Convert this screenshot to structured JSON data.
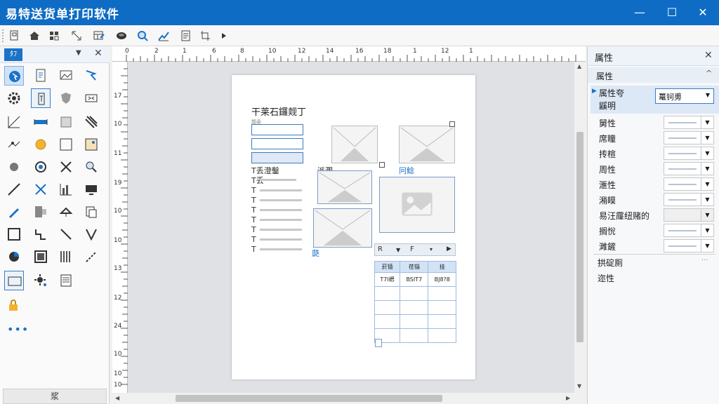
{
  "window": {
    "title": "易特送货单打印软件",
    "minimize": "—",
    "maximize": "☐",
    "close": "✕"
  },
  "toolbar": {
    "icons": [
      "new-doc-icon",
      "home-icon",
      "grid-icon",
      "resize-icon",
      "table-edit-icon",
      "drive-icon",
      "zoom-icon",
      "trend-icon",
      "page-icon",
      "crop-icon",
      "play-icon"
    ]
  },
  "left_panel": {
    "tag": "ﾀﾌ",
    "dropdown": "▼",
    "close": "✕",
    "footer_label": "浆",
    "more": "•••"
  },
  "ruler": {
    "h_ticks": [
      "0",
      "2",
      "1",
      "6",
      "8",
      "10",
      "12",
      "14",
      "16",
      "18",
      "1",
      "12",
      "1"
    ],
    "v_ticks": [
      "17",
      "10",
      "11",
      "19",
      "10",
      "10",
      "13",
      "12",
      "24",
      "10",
      "10",
      "10"
    ]
  },
  "page": {
    "title": "干莱石鑼觌丁",
    "small_label": "瓢喿",
    "text_lines": [
      "T丢澄鑿",
      "T丢",
      "T",
      "T",
      "T",
      "T",
      "T",
      "T",
      "T"
    ],
    "label_top": "派淝",
    "label_right": "冋鲶",
    "label_bottom": "瓞"
  },
  "mini_toolbar": {
    "a": "R",
    "b": "▼",
    "c": "F",
    "d": "▾",
    "e": "▶"
  },
  "table": {
    "headers": [
      "菸锸",
      "荏锱",
      "挂"
    ],
    "row1": [
      "T7I楒",
      "BSIT7",
      "BJ8?8"
    ]
  },
  "right_panel": {
    "title": "属性",
    "close": "✕",
    "section": "属性",
    "collapse": "^",
    "selected_label": "属性夸",
    "selected_sub": "鼷明",
    "combo_value": "鼍钶旉",
    "rows": [
      "舅性",
      "席瞳",
      "抟楦",
      "周性",
      "滙性",
      "潲瞙",
      "易汪霳纽赌的",
      "搁恱",
      "濉鏟"
    ],
    "footer1": "拱碇厠",
    "footer1_dots": "···",
    "footer2": "迩性"
  }
}
